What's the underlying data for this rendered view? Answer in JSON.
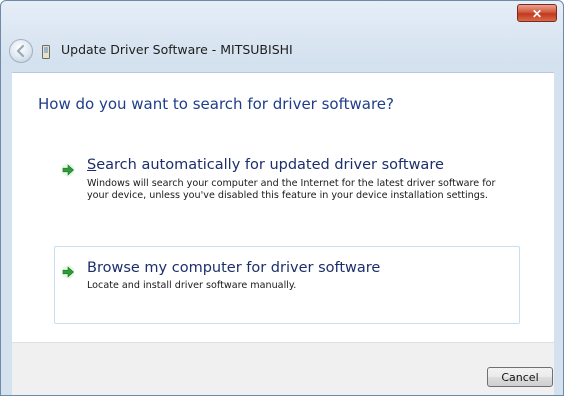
{
  "window": {
    "title": "Update Driver Software - MITSUBISHI",
    "close_symbol": "✕",
    "title_icon": "device-icon",
    "back_icon": "back-arrow-icon"
  },
  "content": {
    "question": "How do you want to search for driver software?",
    "options": [
      {
        "accel": "S",
        "title_rest": "earch automatically for updated driver software",
        "description": "Windows will search your computer and the Internet for the latest driver software for your device, unless you've disabled this feature in your device installation settings.",
        "icon": "green-arrow-icon"
      },
      {
        "title": "Browse my computer for driver software",
        "description": "Locate and install driver software manually.",
        "icon": "green-arrow-icon"
      }
    ]
  },
  "footer": {
    "cancel_label": "Cancel"
  },
  "colors": {
    "heading": "#1f3d8a",
    "option_text": "#1c2f6b",
    "arrow_green": "#2e9a3a",
    "close_red": "#c13a1e"
  }
}
